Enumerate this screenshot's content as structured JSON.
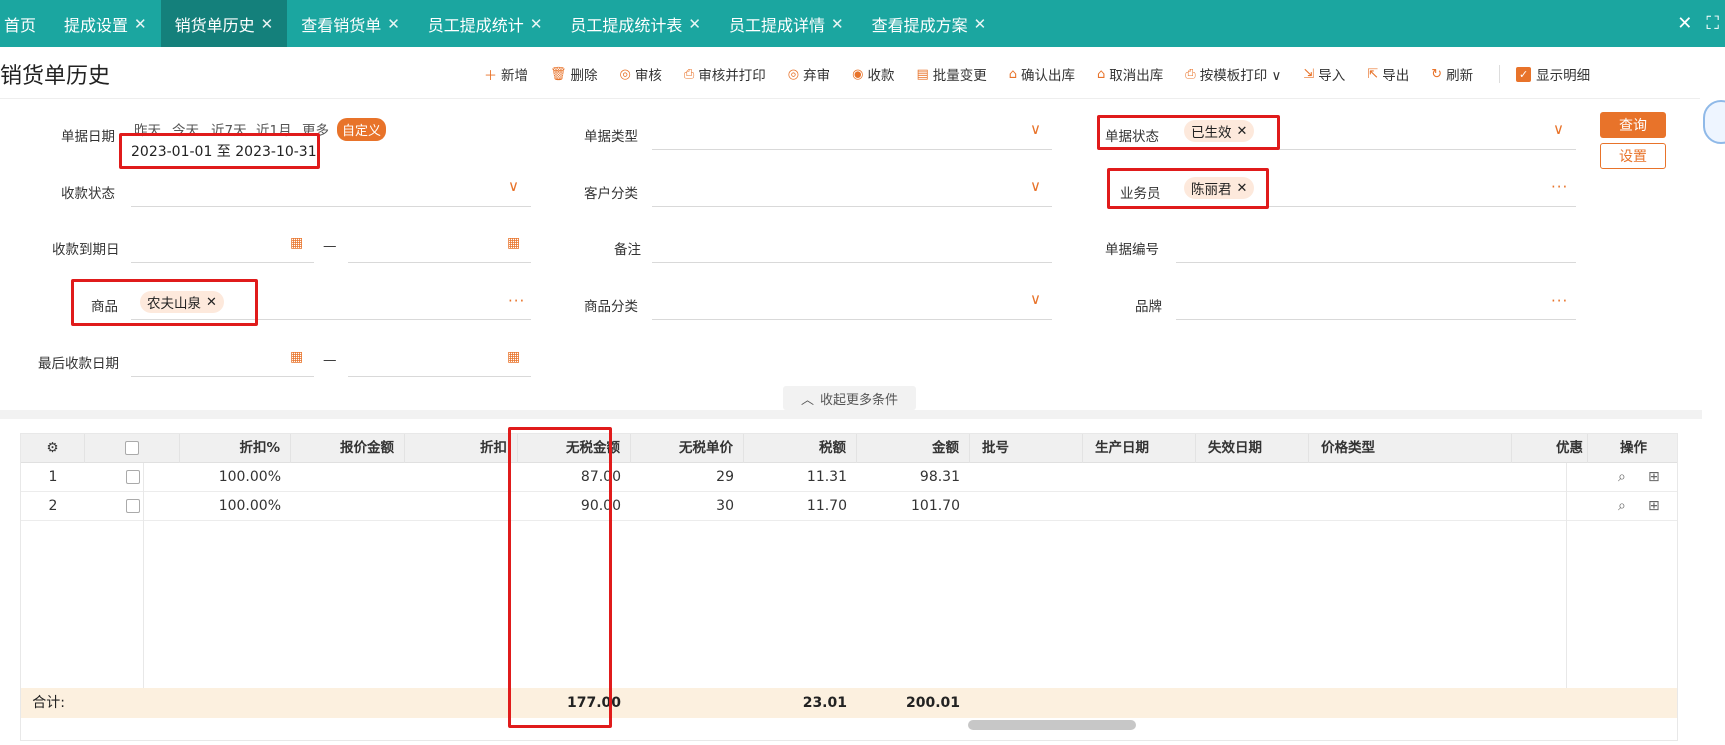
{
  "tabs": [
    {
      "label": "首页",
      "closable": false,
      "active": false
    },
    {
      "label": "提成设置",
      "closable": true,
      "active": false
    },
    {
      "label": "销货单历史",
      "closable": true,
      "active": true
    },
    {
      "label": "查看销货单",
      "closable": true,
      "active": false
    },
    {
      "label": "员工提成统计",
      "closable": true,
      "active": false
    },
    {
      "label": "员工提成统计表",
      "closable": true,
      "active": false
    },
    {
      "label": "员工提成详情",
      "closable": true,
      "active": false
    },
    {
      "label": "查看提成方案",
      "closable": true,
      "active": false
    }
  ],
  "window": {
    "close": "✕",
    "fullscreen": "⛶"
  },
  "page_title": "销货单历史",
  "toolbar": [
    {
      "name": "add",
      "icon": "＋",
      "label": "新增"
    },
    {
      "name": "delete",
      "icon": "🗑",
      "label": "删除"
    },
    {
      "name": "audit",
      "icon": "◎",
      "label": "审核"
    },
    {
      "name": "audit-print",
      "icon": "⎙",
      "label": "审核并打印"
    },
    {
      "name": "unaudit",
      "icon": "◎",
      "label": "弃审"
    },
    {
      "name": "collect",
      "icon": "◉",
      "label": "收款"
    },
    {
      "name": "batch-change",
      "icon": "▤",
      "label": "批量变更"
    },
    {
      "name": "confirm-out",
      "icon": "⌂",
      "label": "确认出库"
    },
    {
      "name": "cancel-out",
      "icon": "⌂",
      "label": "取消出库"
    },
    {
      "name": "template-print",
      "icon": "⎙",
      "label": "按模板打印 ∨"
    },
    {
      "name": "import",
      "icon": "⇲",
      "label": "导入"
    },
    {
      "name": "export",
      "icon": "⇱",
      "label": "导出"
    },
    {
      "name": "refresh",
      "icon": "↻",
      "label": "刷新"
    }
  ],
  "show_detail": {
    "label": "显示明细",
    "checked": true
  },
  "filters": {
    "doc_date": {
      "label": "单据日期",
      "quick": [
        "昨天",
        "今天",
        "近7天",
        "近1月",
        "更多"
      ],
      "active_quick": "自定义",
      "range": "2023-01-01 至 2023-10-31"
    },
    "doc_type": {
      "label": "单据类型"
    },
    "doc_status": {
      "label": "单据状态",
      "chip": "已生效"
    },
    "payment_status": {
      "label": "收款状态"
    },
    "customer_category": {
      "label": "客户分类"
    },
    "salesperson": {
      "label": "业务员",
      "chip": "陈丽君"
    },
    "payment_due_date": {
      "label": "收款到期日",
      "separator": "—"
    },
    "remark": {
      "label": "备注"
    },
    "doc_number": {
      "label": "单据编号"
    },
    "product": {
      "label": "商品",
      "chip": "农夫山泉"
    },
    "product_category": {
      "label": "商品分类"
    },
    "brand": {
      "label": "品牌"
    },
    "last_payment_date": {
      "label": "最后收款日期",
      "separator": "—"
    }
  },
  "buttons": {
    "query": "查询",
    "settings": "设置",
    "collapse": "收起更多条件"
  },
  "table": {
    "columns": [
      "折扣%",
      "报价金额",
      "折扣",
      "无税金额",
      "无税单价",
      "税额",
      "金额",
      "批号",
      "生产日期",
      "失效日期",
      "价格类型",
      "优惠",
      "操作"
    ],
    "rows": [
      {
        "no": "1",
        "discount_pct": "100.00%",
        "quote_amount": "",
        "discount": "",
        "net_amount": "87.00",
        "net_price": "29",
        "tax": "11.31",
        "amount": "98.31"
      },
      {
        "no": "2",
        "discount_pct": "100.00%",
        "quote_amount": "",
        "discount": "",
        "net_amount": "90.00",
        "net_price": "30",
        "tax": "11.70",
        "amount": "101.70"
      }
    ],
    "footer": {
      "label": "合计:",
      "net_amount": "177.00",
      "tax": "23.01",
      "amount": "200.01"
    }
  },
  "colors": {
    "accent": "#e8732a",
    "tabbar": "#1ba6a0",
    "highlight_box": "#e01b1b",
    "footer_bg": "#fcf0df"
  }
}
